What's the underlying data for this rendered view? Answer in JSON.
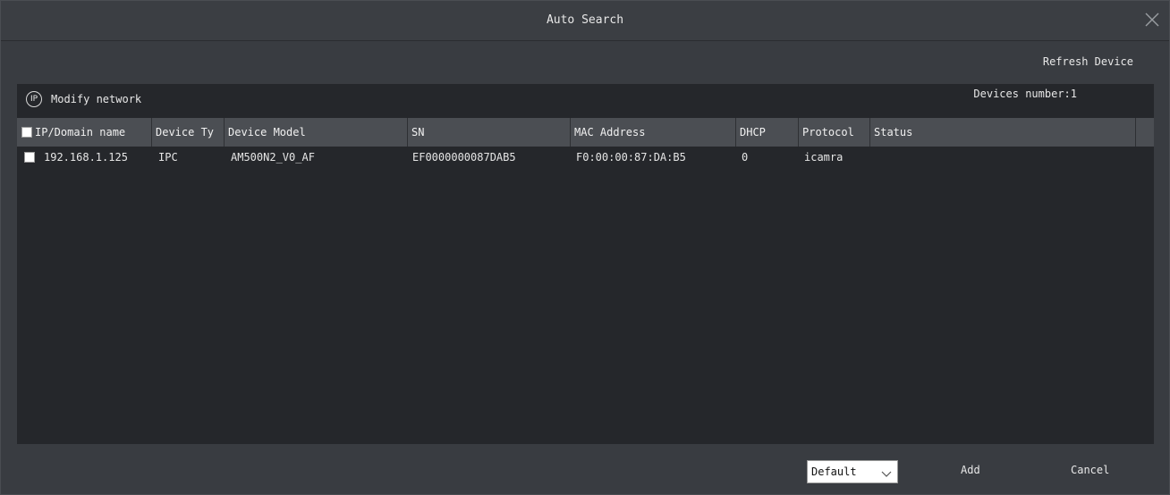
{
  "window": {
    "title": "Auto Search"
  },
  "toolbar": {
    "refresh_label": "Refresh Device",
    "modify_label": "Modify network",
    "modify_icon_text": "IP",
    "devices_number": "Devices number:1"
  },
  "table": {
    "columns": [
      "IP/Domain name",
      "Device Ty",
      "Device Model",
      "SN",
      "MAC Address",
      "DHCP",
      "Protocol",
      "Status"
    ],
    "rows": [
      {
        "ip": "192.168.1.125",
        "type": "IPC",
        "model": "AM500N2_V0_AF",
        "sn": "EF0000000087DAB5",
        "mac": "F0:00:00:87:DA:B5",
        "dhcp": "0",
        "protocol": "icamra",
        "status": ""
      }
    ]
  },
  "footer": {
    "select_value": "Default",
    "add_label": "Add",
    "cancel_label": "Cancel"
  },
  "icons": {
    "close": "close-icon",
    "ip": "ip-icon",
    "dropdown": "chevron-down-icon"
  }
}
